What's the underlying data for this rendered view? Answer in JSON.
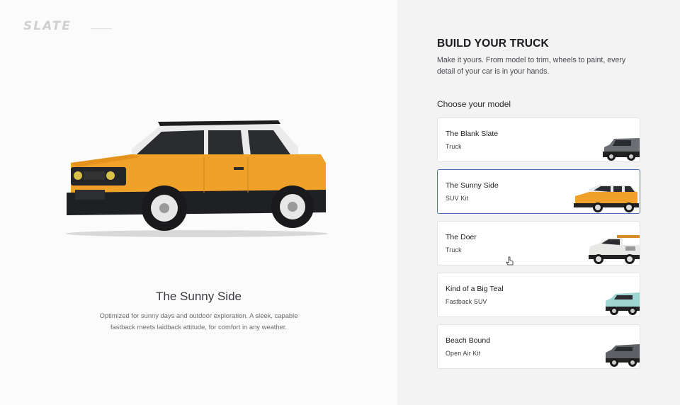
{
  "brand": {
    "logo": "SLATE"
  },
  "hero": {
    "title": "The Sunny Side",
    "description": "Optimized for sunny days and outdoor exploration. A sleek, capable fastback meets laidback attitude, for comfort in any weather.",
    "vehicle_color": "#f0a12a",
    "roof_color": "#e9e9e9"
  },
  "builder": {
    "title": "BUILD YOUR TRUCK",
    "description": "Make it yours. From model to trim, wheels to paint, every detail of your car is in your hands.",
    "choose_label": "Choose your model",
    "models": [
      {
        "name": "The Blank Slate",
        "type": "Truck",
        "color": "#6b6e72",
        "selected": false
      },
      {
        "name": "The Sunny Side",
        "type": "SUV Kit",
        "color": "#f0a12a",
        "selected": true
      },
      {
        "name": "The Doer",
        "type": "Truck",
        "color": "#e8e8e6",
        "selected": false
      },
      {
        "name": "Kind of a Big Teal",
        "type": "Fastback SUV",
        "color": "#9fd6d2",
        "selected": false
      },
      {
        "name": "Beach Bound",
        "type": "Open Air Kit",
        "color": "#5d6165",
        "selected": false
      }
    ],
    "accent_color": "#4e6fb8"
  }
}
